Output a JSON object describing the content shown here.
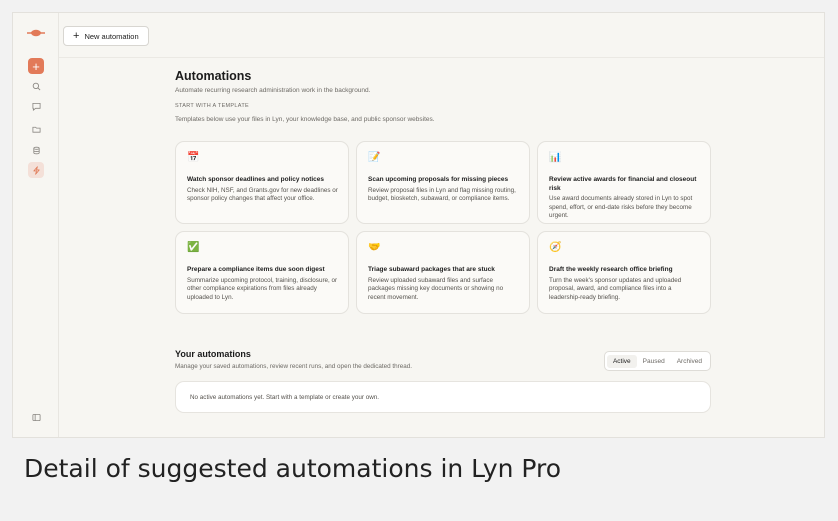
{
  "topbar": {
    "new_automation_label": "New automation"
  },
  "sidebar": {
    "icons": [
      "logo-icon",
      "new-chat-icon",
      "search-icon",
      "chat-icon",
      "folder-icon",
      "database-icon",
      "automation-icon",
      "sidebar-toggle-icon"
    ],
    "accent": "#e27a59"
  },
  "main": {
    "title": "Automations",
    "subtitle": "Automate recurring research administration work in the background.",
    "template_section_label": "START WITH A TEMPLATE",
    "template_section_desc": "Templates below use your files in Lyn, your knowledge base, and public sponsor websites.",
    "cards": [
      {
        "emoji": "📅",
        "title": "Watch sponsor deadlines and policy notices",
        "desc": "Check NIH, NSF, and Grants.gov for new deadlines or sponsor policy changes that affect your office."
      },
      {
        "emoji": "📝",
        "title": "Scan upcoming proposals for missing pieces",
        "desc": "Review proposal files in Lyn and flag missing routing, budget, biosketch, subaward, or compliance items."
      },
      {
        "emoji": "📊",
        "title": "Review active awards for financial and closeout risk",
        "desc": "Use award documents already stored in Lyn to spot spend, effort, or end-date risks before they become urgent."
      },
      {
        "emoji": "✅",
        "title": "Prepare a compliance items due soon digest",
        "desc": "Summarize upcoming protocol, training, disclosure, or other compliance expirations from files already uploaded to Lyn."
      },
      {
        "emoji": "🤝",
        "title": "Triage subaward packages that are stuck",
        "desc": "Review uploaded subaward files and surface packages missing key documents or showing no recent movement."
      },
      {
        "emoji": "🧭",
        "title": "Draft the weekly research office briefing",
        "desc": "Turn the week's sponsor updates and uploaded proposal, award, and compliance files into a leadership-ready briefing."
      }
    ],
    "your_automations": {
      "heading": "Your automations",
      "desc": "Manage your saved automations, review recent runs, and open the dedicated thread.",
      "tabs": [
        "Active",
        "Paused",
        "Archived"
      ],
      "active_tab": "Active",
      "empty_text": "No active automations yet. Start with a template or create your own."
    }
  },
  "caption": "Detail of suggested automations in Lyn Pro"
}
